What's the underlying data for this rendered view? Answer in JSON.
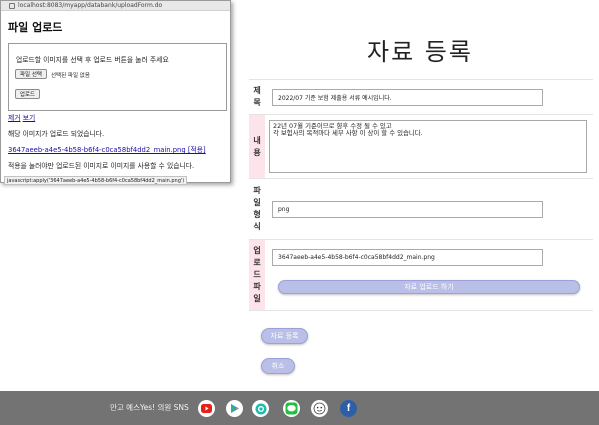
{
  "popup": {
    "url": "localhost:8083/myapp/databank/uploadForm.do",
    "title": "파일 업로드",
    "instruction": "업로드할 이미지를 선택 후 업로드 버튼을 눌러 주세요",
    "choose_file_button": "파일 선택",
    "no_file_text": "선택된 파일 없음",
    "upload_button": "업로드",
    "remove_link": "제거",
    "view_link": "보기",
    "uploaded_message": "해당 이미지가 업로드 되었습니다.",
    "uploaded_file_link": "3647aeeb-a4e5-4b58-b6f4-c0ca58bf4dd2_main.png [적용]",
    "apply_note": "적용을 눌러야만 업로드된 이미지로 이미지를 사용할 수 있습니다.",
    "status_tooltip": "javascript:apply('3647aeeb-a4e5-4b58-b6f4-c0ca58bf4dd2_main.png')"
  },
  "page": {
    "title": "자료 등록"
  },
  "form": {
    "title_label": "제목",
    "title_value": "2022/07 기준 보험 제출용 서류 예시입니다.",
    "content_label": "내용",
    "content_value": "22년 07월 기준이므로 향후 수정 될 수 있고\n각 보험사의 목적마다 세부 사항 이 상이 할 수 있습니다.",
    "filetype_label": "파일형식",
    "filetype_value": "png",
    "upload_file_label": "업로드파일",
    "upload_file_value": "3647aeeb-a4e5-4b58-b6f4-c0ca58bf4dd2_main.png",
    "upload_button": "자료 업로드 하기"
  },
  "actions": {
    "register": "자료 등록",
    "cancel": "취소"
  },
  "footer": {
    "text": "만고 예스Yes! 의원 SNS",
    "sns": [
      {
        "icon": "youtube-icon",
        "color": "#e62117"
      },
      {
        "icon": "play-store-icon",
        "color": "#3c8df5"
      },
      {
        "icon": "teal-circle-icon",
        "color": "#1fbcae"
      },
      {
        "icon": "line-icon",
        "color": "#21c043"
      },
      {
        "icon": "character-icon",
        "color": "#444444"
      },
      {
        "icon": "facebook-icon",
        "color": "#2d5fa8"
      }
    ]
  },
  "colors": {
    "label_bg": "#fde4ea",
    "pill_bg": "#b9bfe6",
    "footer_bg": "#737373",
    "link": "#1a0dab"
  }
}
